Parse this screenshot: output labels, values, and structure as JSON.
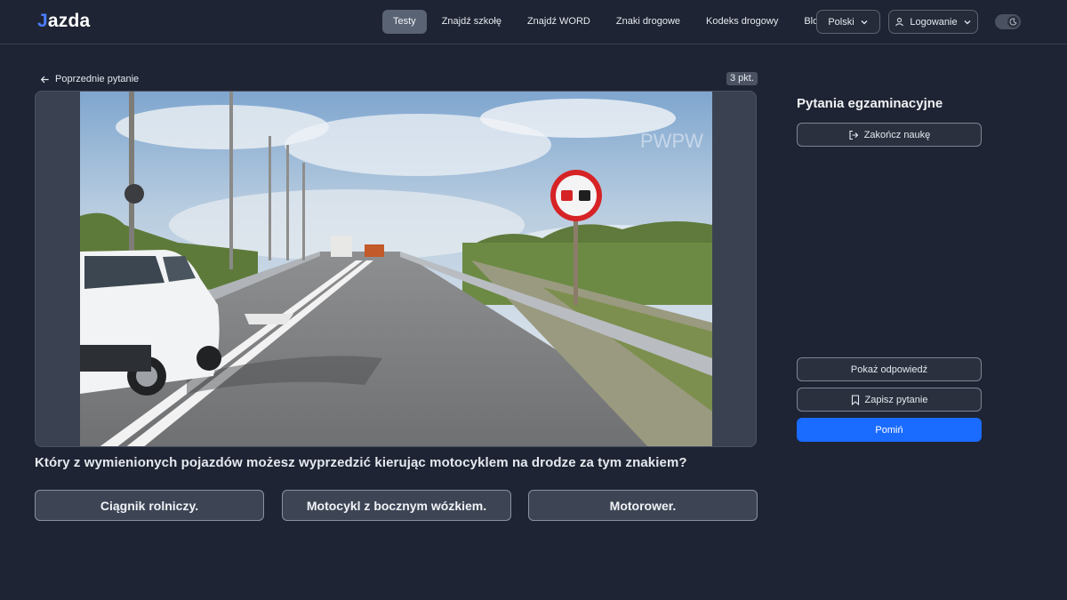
{
  "header": {
    "logo_text": "azda",
    "logo_letter": "J",
    "nav": [
      {
        "label": "Testy",
        "active": true
      },
      {
        "label": "Znajdź szkołę",
        "active": false
      },
      {
        "label": "Znajdź WORD",
        "active": false
      },
      {
        "label": "Znaki drogowe",
        "active": false
      },
      {
        "label": "Kodeks drogowy",
        "active": false
      },
      {
        "label": "Blog",
        "active": false
      }
    ],
    "language": "Polski",
    "login": "Logowanie",
    "theme_toggle_icon": "moon-icon"
  },
  "question_panel": {
    "prev_link": "Poprzednie pytanie",
    "points": "3 pkt.",
    "image_watermark": "PWPW",
    "question": "Który z wymienionych pojazdów możesz wyprzedzić kierując motocyklem na drodze za tym znakiem?",
    "answers": [
      "Ciągnik rolniczy.",
      "Motocykl z bocznym wózkiem.",
      "Motorower."
    ]
  },
  "sidebar": {
    "title": "Pytania egzaminacyjne",
    "finish_label": "Zakończ naukę",
    "show_answer_label": "Pokaż odpowiedź",
    "save_label": "Zapisz pytanie",
    "skip_label": "Pomiń"
  },
  "colors": {
    "background": "#1e2433",
    "accent": "#1a6bff",
    "logo_accent": "#4a7dff"
  }
}
